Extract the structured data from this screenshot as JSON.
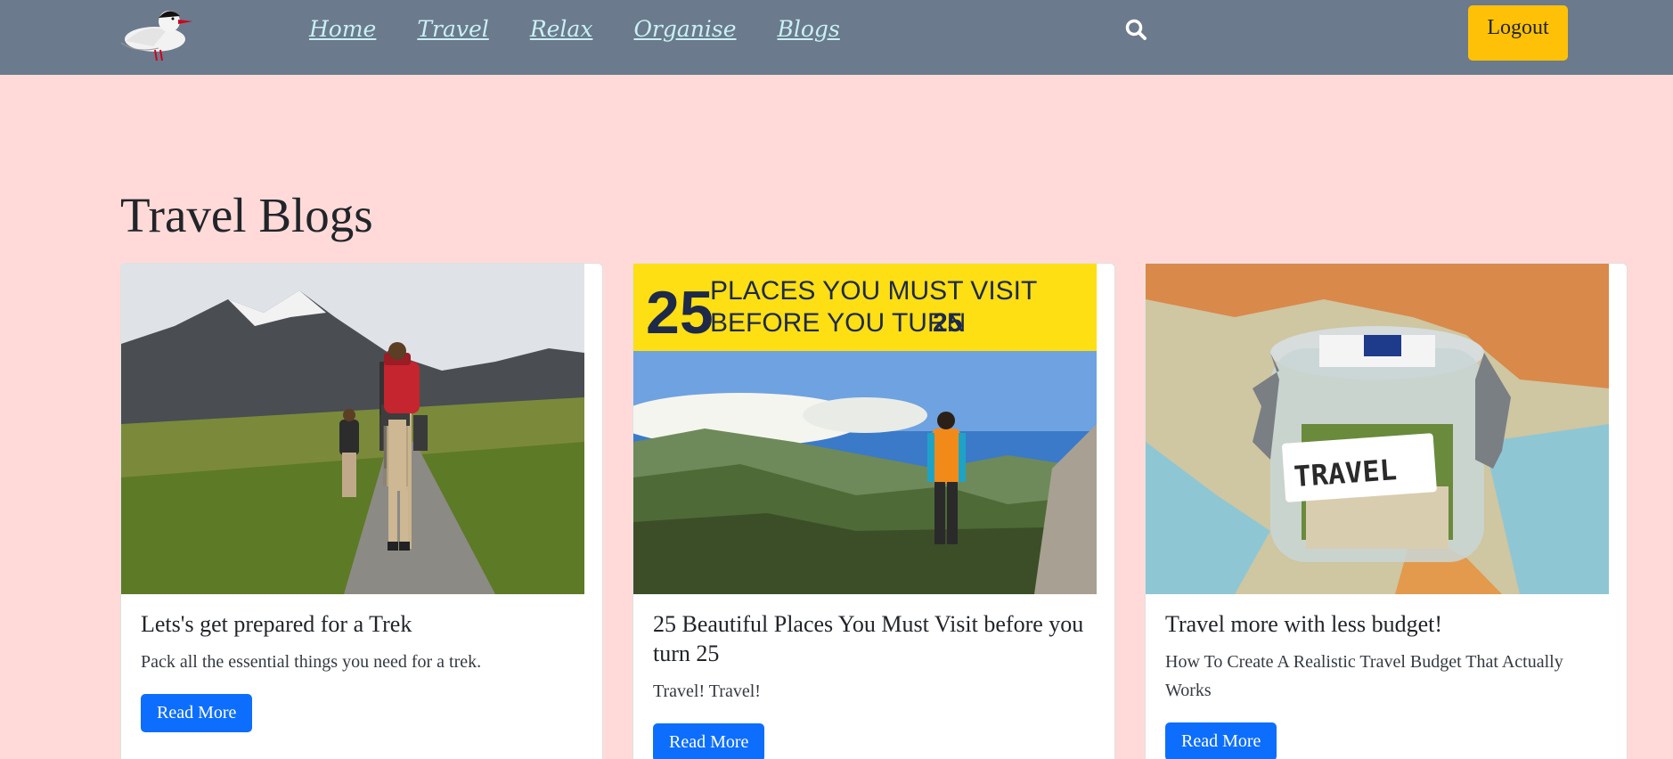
{
  "nav": {
    "links": [
      "Home",
      "Travel",
      "Relax",
      "Organise",
      "Blogs"
    ],
    "logout_label": "Logout",
    "search_icon": "search-icon",
    "logo_icon": "bird-logo-icon"
  },
  "page": {
    "title": "Travel Blogs"
  },
  "cards": [
    {
      "title": "Lets's get prepared for a Trek",
      "text": "Pack all the essential things you need for a trek.",
      "button": "Read More",
      "image": "hikers-mountain-trail"
    },
    {
      "title": "25 Beautiful Places You Must Visit before you turn 25",
      "text": "Travel! Travel!",
      "button": "Read More",
      "image_banner_number": "25",
      "image_banner_line1": "PLACES YOU MUST VISIT",
      "image_banner_line2": "BEFORE YOU TURN",
      "image_banner_number2": "25"
    },
    {
      "title": "Travel more with less budget!",
      "text": "How To Create A Realistic Travel Budget That Actually Works",
      "button": "Read More",
      "image_label": "TRAVEL"
    }
  ],
  "colors": {
    "navbar": "#6b7a8c",
    "page_bg": "#ffdad9",
    "logout": "#ffc107",
    "primary": "#0d6efd",
    "nav_link": "#c8f1f4"
  }
}
